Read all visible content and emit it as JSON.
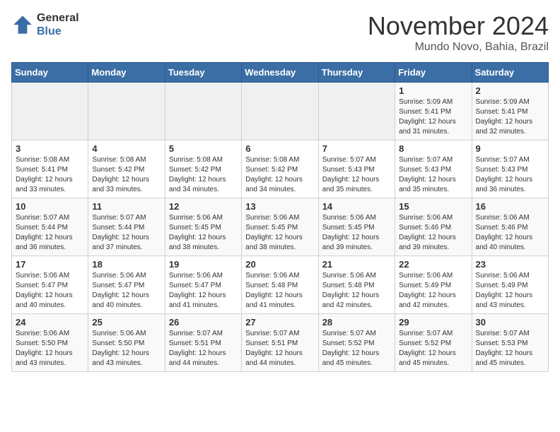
{
  "logo": {
    "general": "General",
    "blue": "Blue"
  },
  "header": {
    "month": "November 2024",
    "location": "Mundo Novo, Bahia, Brazil"
  },
  "days_of_week": [
    "Sunday",
    "Monday",
    "Tuesday",
    "Wednesday",
    "Thursday",
    "Friday",
    "Saturday"
  ],
  "weeks": [
    [
      {
        "day": "",
        "info": ""
      },
      {
        "day": "",
        "info": ""
      },
      {
        "day": "",
        "info": ""
      },
      {
        "day": "",
        "info": ""
      },
      {
        "day": "",
        "info": ""
      },
      {
        "day": "1",
        "info": "Sunrise: 5:09 AM\nSunset: 5:41 PM\nDaylight: 12 hours\nand 31 minutes."
      },
      {
        "day": "2",
        "info": "Sunrise: 5:09 AM\nSunset: 5:41 PM\nDaylight: 12 hours\nand 32 minutes."
      }
    ],
    [
      {
        "day": "3",
        "info": "Sunrise: 5:08 AM\nSunset: 5:41 PM\nDaylight: 12 hours\nand 33 minutes."
      },
      {
        "day": "4",
        "info": "Sunrise: 5:08 AM\nSunset: 5:42 PM\nDaylight: 12 hours\nand 33 minutes."
      },
      {
        "day": "5",
        "info": "Sunrise: 5:08 AM\nSunset: 5:42 PM\nDaylight: 12 hours\nand 34 minutes."
      },
      {
        "day": "6",
        "info": "Sunrise: 5:08 AM\nSunset: 5:42 PM\nDaylight: 12 hours\nand 34 minutes."
      },
      {
        "day": "7",
        "info": "Sunrise: 5:07 AM\nSunset: 5:43 PM\nDaylight: 12 hours\nand 35 minutes."
      },
      {
        "day": "8",
        "info": "Sunrise: 5:07 AM\nSunset: 5:43 PM\nDaylight: 12 hours\nand 35 minutes."
      },
      {
        "day": "9",
        "info": "Sunrise: 5:07 AM\nSunset: 5:43 PM\nDaylight: 12 hours\nand 36 minutes."
      }
    ],
    [
      {
        "day": "10",
        "info": "Sunrise: 5:07 AM\nSunset: 5:44 PM\nDaylight: 12 hours\nand 36 minutes."
      },
      {
        "day": "11",
        "info": "Sunrise: 5:07 AM\nSunset: 5:44 PM\nDaylight: 12 hours\nand 37 minutes."
      },
      {
        "day": "12",
        "info": "Sunrise: 5:06 AM\nSunset: 5:45 PM\nDaylight: 12 hours\nand 38 minutes."
      },
      {
        "day": "13",
        "info": "Sunrise: 5:06 AM\nSunset: 5:45 PM\nDaylight: 12 hours\nand 38 minutes."
      },
      {
        "day": "14",
        "info": "Sunrise: 5:06 AM\nSunset: 5:45 PM\nDaylight: 12 hours\nand 39 minutes."
      },
      {
        "day": "15",
        "info": "Sunrise: 5:06 AM\nSunset: 5:46 PM\nDaylight: 12 hours\nand 39 minutes."
      },
      {
        "day": "16",
        "info": "Sunrise: 5:06 AM\nSunset: 5:46 PM\nDaylight: 12 hours\nand 40 minutes."
      }
    ],
    [
      {
        "day": "17",
        "info": "Sunrise: 5:06 AM\nSunset: 5:47 PM\nDaylight: 12 hours\nand 40 minutes."
      },
      {
        "day": "18",
        "info": "Sunrise: 5:06 AM\nSunset: 5:47 PM\nDaylight: 12 hours\nand 40 minutes."
      },
      {
        "day": "19",
        "info": "Sunrise: 5:06 AM\nSunset: 5:47 PM\nDaylight: 12 hours\nand 41 minutes."
      },
      {
        "day": "20",
        "info": "Sunrise: 5:06 AM\nSunset: 5:48 PM\nDaylight: 12 hours\nand 41 minutes."
      },
      {
        "day": "21",
        "info": "Sunrise: 5:06 AM\nSunset: 5:48 PM\nDaylight: 12 hours\nand 42 minutes."
      },
      {
        "day": "22",
        "info": "Sunrise: 5:06 AM\nSunset: 5:49 PM\nDaylight: 12 hours\nand 42 minutes."
      },
      {
        "day": "23",
        "info": "Sunrise: 5:06 AM\nSunset: 5:49 PM\nDaylight: 12 hours\nand 43 minutes."
      }
    ],
    [
      {
        "day": "24",
        "info": "Sunrise: 5:06 AM\nSunset: 5:50 PM\nDaylight: 12 hours\nand 43 minutes."
      },
      {
        "day": "25",
        "info": "Sunrise: 5:06 AM\nSunset: 5:50 PM\nDaylight: 12 hours\nand 43 minutes."
      },
      {
        "day": "26",
        "info": "Sunrise: 5:07 AM\nSunset: 5:51 PM\nDaylight: 12 hours\nand 44 minutes."
      },
      {
        "day": "27",
        "info": "Sunrise: 5:07 AM\nSunset: 5:51 PM\nDaylight: 12 hours\nand 44 minutes."
      },
      {
        "day": "28",
        "info": "Sunrise: 5:07 AM\nSunset: 5:52 PM\nDaylight: 12 hours\nand 45 minutes."
      },
      {
        "day": "29",
        "info": "Sunrise: 5:07 AM\nSunset: 5:52 PM\nDaylight: 12 hours\nand 45 minutes."
      },
      {
        "day": "30",
        "info": "Sunrise: 5:07 AM\nSunset: 5:53 PM\nDaylight: 12 hours\nand 45 minutes."
      }
    ]
  ]
}
